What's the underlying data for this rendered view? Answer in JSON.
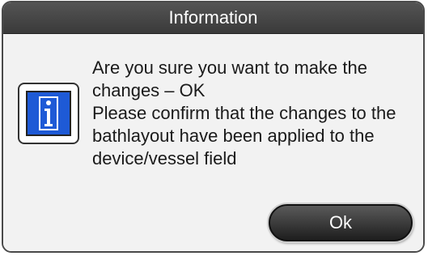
{
  "dialog": {
    "title": "Information",
    "icon": "info-icon",
    "message_lines": [
      "Are you sure you want to make the",
      "changes – OK",
      "Please confirm that the changes to the",
      "bathlayout have been applied to the",
      "device/vessel field"
    ],
    "ok_label": "Ok"
  },
  "colors": {
    "titlebar": "#454545",
    "icon_blue": "#1e5ad6",
    "button": "#2a2a2a"
  }
}
